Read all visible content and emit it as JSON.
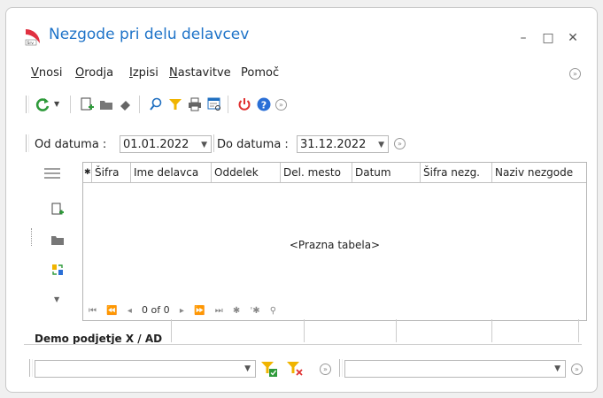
{
  "window": {
    "title": "Nezgode pri delu delavcev",
    "minimize_glyph": "–",
    "maximize_glyph": "□",
    "close_glyph": "✕"
  },
  "menu": {
    "items": [
      {
        "accel": "V",
        "rest": "nosi"
      },
      {
        "accel": "O",
        "rest": "rodja"
      },
      {
        "accel": "I",
        "rest": "zpisi"
      },
      {
        "accel": "N",
        "rest": "astavitve"
      },
      {
        "accel": "",
        "rest": "Pomoč"
      }
    ]
  },
  "toolbar": {
    "icons": [
      "refresh-icon",
      "new-record-icon",
      "open-folder-icon",
      "eraser-icon",
      "search-icon",
      "filter-icon",
      "print-icon",
      "report-icon",
      "power-icon",
      "help-icon"
    ]
  },
  "dates": {
    "from_label": "Od datuma :",
    "from_value": "01.01.2022",
    "to_label": "Do datuma :",
    "to_value": "31.12.2022"
  },
  "grid": {
    "columns": [
      "✱",
      "Šifra",
      "Ime delavca",
      "Oddelek",
      "Del. mesto",
      "Datum",
      "Šifra nezg.",
      "Naziv nezgode"
    ],
    "empty_text": "<Prazna tabela>",
    "nav": {
      "first": "⏮",
      "prev_page": "⏪",
      "prev": "◂",
      "record_count": "0 of 0",
      "next": "▸",
      "next_page": "⏩",
      "last": "⏭",
      "add": "✱",
      "edit": "'✱",
      "filter": "⚲"
    }
  },
  "bottom": {
    "tab_label": "Demo podjetje X / AD"
  },
  "colors": {
    "title": "#1e73c8",
    "refresh_green": "#2e9a3a",
    "filter_yellow": "#f0b400",
    "power_red": "#e03030",
    "help_blue": "#2a6fd6"
  }
}
